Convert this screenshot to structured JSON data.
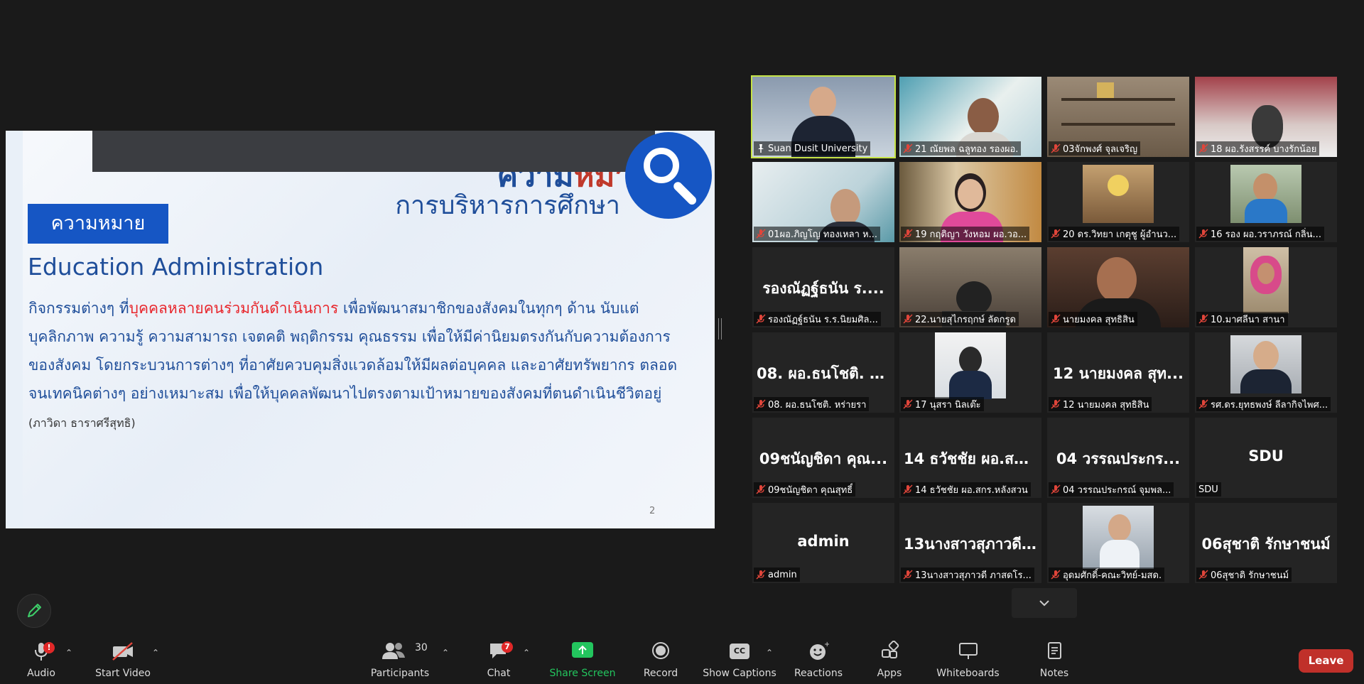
{
  "slide": {
    "title_main_a": "ความ",
    "title_main_b": "หมาย",
    "title_sub": "การบริหารการศึกษา",
    "heading": "ความหมาย",
    "subtitle": "Education Administration",
    "body_pre": "กิจกรรมต่างๆ ที่",
    "body_highlight": "บุคคลหลายคนร่วมกันดำเนินการ",
    "body_post": " เพื่อพัฒนาสมาชิกของสังคมในทุกๆ ด้าน นับแต่ บุคลิกภาพ ความรู้ ความสามารถ เจตคติ พฤติกรรม คุณธรรม เพื่อให้มีค่านิยมตรงกันกับความต้องการของสังคม โดยกระบวนการต่างๆ ที่อาศัยควบคุมสิ่งแวดล้อมให้มีผลต่อบุคคล และอาศัยทรัพยากร ตลอดจนเทคนิคต่างๆ อย่างเหมาะสม เพื่อให้บุคคลพัฒนาไปตรงตามเป้าหมายของสังคมที่ตนดำเนินชีวิตอยู่ ",
    "body_citation": "(ภาวิดา ธาราศรีสุทธิ)",
    "page_number": "2"
  },
  "gallery": {
    "tiles": [
      {
        "name": "Suan Dusit University",
        "initials": "",
        "video": "presenter",
        "active": true,
        "pinned": true
      },
      {
        "name": "21 ณัยพล ฉลูทอง รองผอ.",
        "initials": "",
        "video": "man-banner",
        "active": false,
        "pinned": false
      },
      {
        "name": "03จักพงศ์ จุลเจริญ",
        "initials": "",
        "video": "shelf",
        "active": false,
        "pinned": false
      },
      {
        "name": "18 ผอ.รังสรรค์ บางรักน้อย",
        "initials": "",
        "video": "blurred-red",
        "active": false,
        "pinned": false
      },
      {
        "name": "01ผอ.ภิญโญ  ทองเหลา ห...",
        "initials": "",
        "video": "man-banner-2",
        "active": false,
        "pinned": false
      },
      {
        "name": "19 กฤติญา วังหอม ผอ.วอ...",
        "initials": "",
        "video": "woman-flowers",
        "active": false,
        "pinned": false
      },
      {
        "name": "20 ดร.วิทยา เกตุชู ผู้อำนว...",
        "initials": "",
        "video": "logo-small",
        "active": false,
        "pinned": false
      },
      {
        "name": "16 รอง ผอ.วราภรณ์ กลิ่น...",
        "initials": "",
        "video": "woman-small",
        "active": false,
        "pinned": false
      },
      {
        "name": "รองณัฏฐ์ธนัน ร.ร.นิยมศิล...",
        "initials": "รองณัฏฐ์ธนัน  ร....",
        "video": "",
        "active": false,
        "pinned": false
      },
      {
        "name": "22.นายสุไกรฤกษ์ ลัดกรูด",
        "initials": "",
        "video": "man-dark",
        "active": false,
        "pinned": false
      },
      {
        "name": "นายมงคล สุทธิสิน",
        "initials": "",
        "video": "man-glasses",
        "active": false,
        "pinned": false
      },
      {
        "name": "10.มาศลีนา  สานา",
        "initials": "",
        "video": "woman-hijab",
        "active": false,
        "pinned": false
      },
      {
        "name": "08. ผอ.ธนโชติ. หร่ายรา",
        "initials": "08. ผอ.ธนโชติ. ห...",
        "video": "",
        "active": false,
        "pinned": false
      },
      {
        "name": "17 นุสรา นิลเต๊ะ",
        "initials": "",
        "video": "woman-desk",
        "active": false,
        "pinned": false
      },
      {
        "name": "12 นายมงคล สุทธิสิน",
        "initials": "12 นายมงคล สุท...",
        "video": "",
        "active": false,
        "pinned": false
      },
      {
        "name": "รศ.ดร.ยุทธพงษ์ ลีลากิจไพศ...",
        "initials": "",
        "video": "man-portrait",
        "active": false,
        "pinned": false
      },
      {
        "name": "09ชนัญชิดา  คุณสุทธิ์",
        "initials": "09ชนัญชิดา  คุณ...",
        "video": "",
        "active": false,
        "pinned": false
      },
      {
        "name": "14 ธวัชชัย ผอ.สกร.หลังสวน",
        "initials": "14 ธวัชชัย ผอ.สก...",
        "video": "",
        "active": false,
        "pinned": false
      },
      {
        "name": "04 วรรณประกรณ์  จุมพล...",
        "initials": "04 วรรณประกร...",
        "video": "",
        "active": false,
        "pinned": false
      },
      {
        "name": "SDU",
        "initials": "SDU",
        "video": "",
        "active": false,
        "pinned": false,
        "muted": false
      },
      {
        "name": "admin",
        "initials": "admin",
        "video": "",
        "active": false,
        "pinned": false
      },
      {
        "name": "13นางสาวสุภาวดี ภาสดโร...",
        "initials": "13นางสาวสุภาวดี...",
        "video": "",
        "active": false,
        "pinned": false
      },
      {
        "name": "อุดมศักดิ์-คณะวิทย์-มสด.",
        "initials": "",
        "video": "man-sign",
        "active": false,
        "pinned": false
      },
      {
        "name": "06สุชาติ รักษาชนม์",
        "initials": "06สุชาติ  รักษาชนม์",
        "video": "",
        "active": false,
        "pinned": false
      }
    ]
  },
  "toolbar": {
    "audio": {
      "label": "Audio",
      "alert": "!"
    },
    "video": {
      "label": "Start Video"
    },
    "participants": {
      "label": "Participants",
      "count": "30"
    },
    "chat": {
      "label": "Chat",
      "badge": "7"
    },
    "share": {
      "label": "Share Screen"
    },
    "record": {
      "label": "Record"
    },
    "captions": {
      "label": "Show Captions",
      "icon_text": "CC"
    },
    "reactions": {
      "label": "Reactions"
    },
    "apps": {
      "label": "Apps"
    },
    "whiteboards": {
      "label": "Whiteboards"
    },
    "notes": {
      "label": "Notes"
    },
    "leave": {
      "label": "Leave"
    }
  },
  "colors": {
    "active_speaker": "#c6e346",
    "share_green": "#23c55e",
    "leave_red": "#c0302a",
    "mute_red": "#e0453a",
    "slide_blue": "#1f4e9a"
  }
}
